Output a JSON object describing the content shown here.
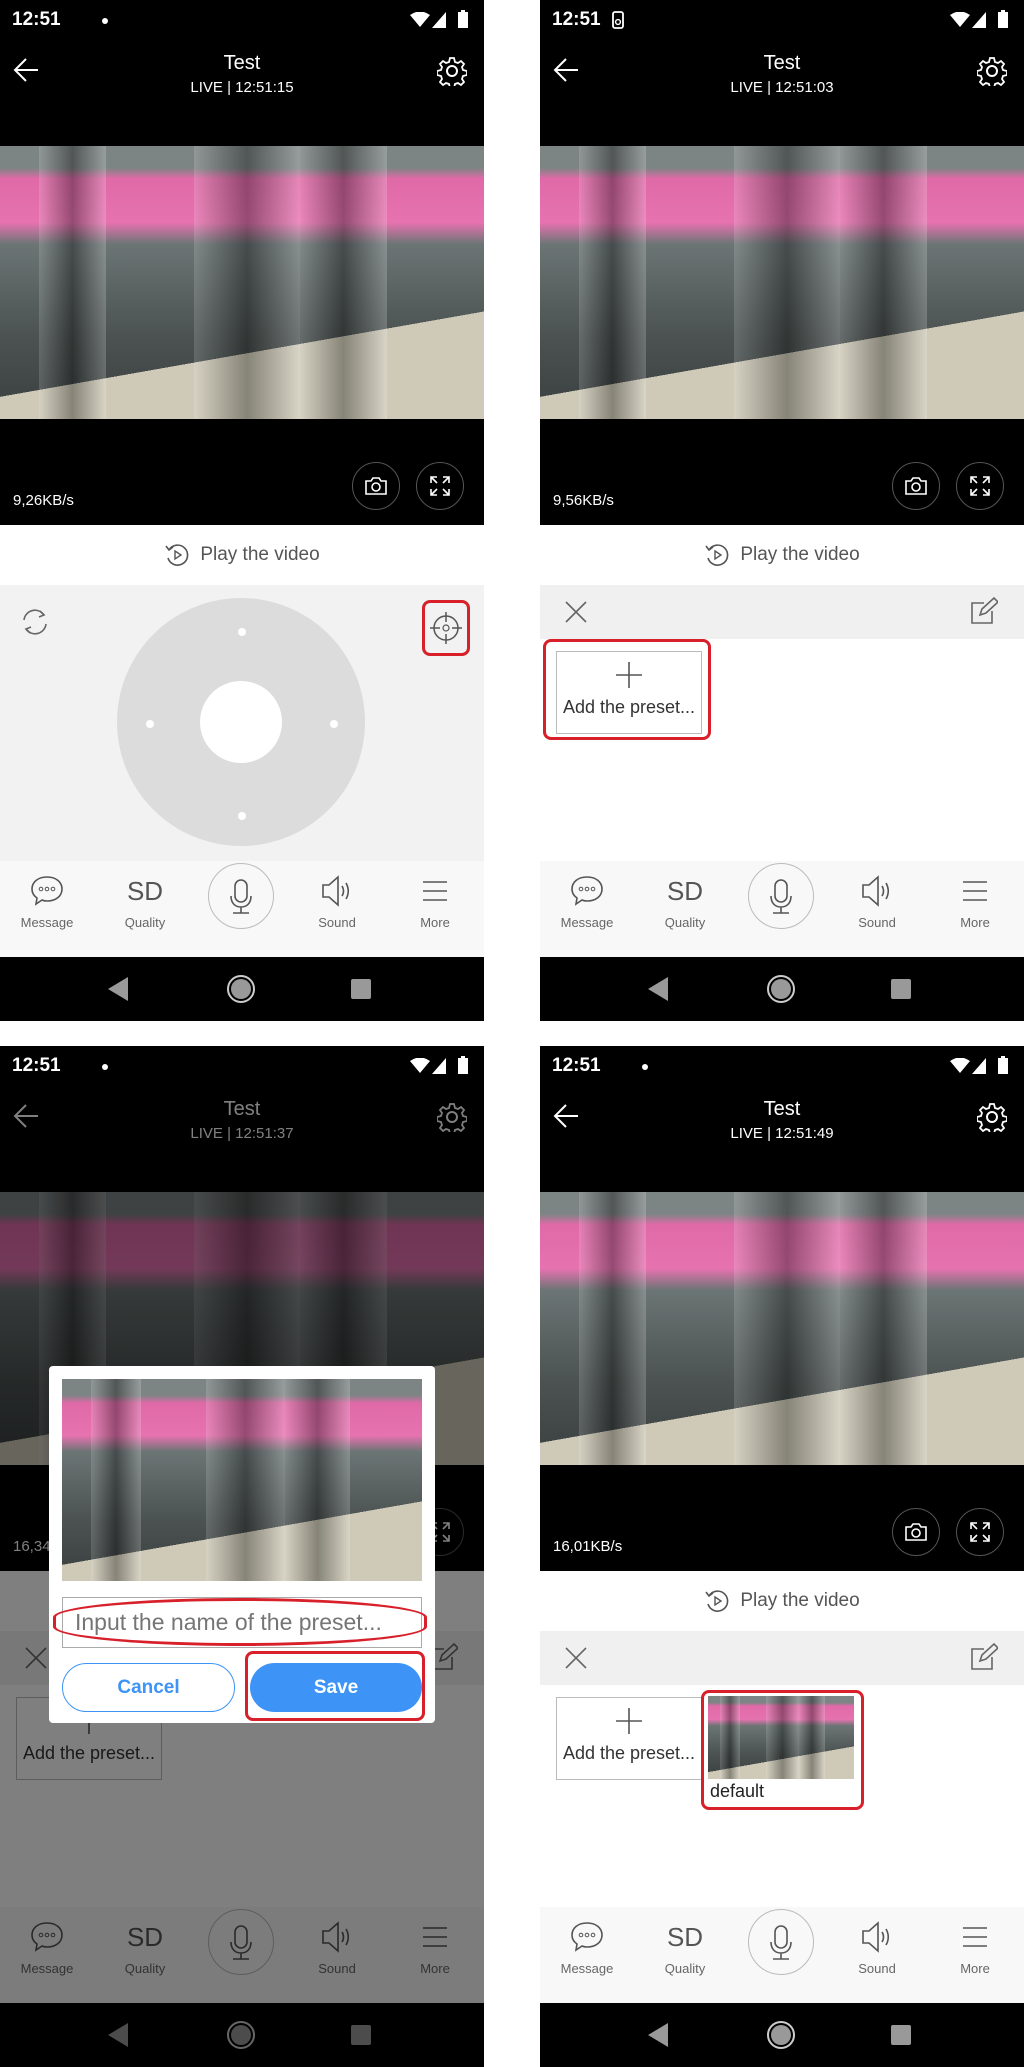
{
  "colors": {
    "accent": "#3d94f6",
    "highlight": "#d8202a",
    "control_bg": "#f2f2f2",
    "joystick": "#dcdcdc"
  },
  "common": {
    "title": "Test",
    "play_label": "Play the video",
    "add_preset_label": "Add the preset...",
    "toolbar": [
      {
        "label": "Message",
        "icon": "message-icon"
      },
      {
        "label": "Quality",
        "icon": "sd-quality-icon",
        "glyph": "SD"
      },
      {
        "label": "",
        "icon": "microphone-icon"
      },
      {
        "label": "Sound",
        "icon": "speaker-icon"
      },
      {
        "label": "More",
        "icon": "menu-icon"
      }
    ]
  },
  "panels": [
    {
      "status_time": "12:51",
      "notif_icon": "dot-icon",
      "subtitle": "LIVE | 12:51:15",
      "rate": "9,26KB/s",
      "mode": "joystick"
    },
    {
      "status_time": "12:51",
      "notif_icon": "phone-notification-icon",
      "subtitle": "LIVE | 12:51:03",
      "rate": "9,56KB/s",
      "mode": "preset"
    },
    {
      "status_time": "12:51",
      "notif_icon": "dot-icon",
      "subtitle": "LIVE | 12:51:37",
      "rate": "16,34KB/s",
      "mode": "preset",
      "dialog": {
        "placeholder": "Input the name of the preset...",
        "cancel": "Cancel",
        "save": "Save"
      }
    },
    {
      "status_time": "12:51",
      "notif_icon": "dot-icon",
      "subtitle": "LIVE | 12:51:49",
      "rate": "16,01KB/s",
      "mode": "preset",
      "presets": [
        {
          "name": "default"
        }
      ]
    }
  ]
}
